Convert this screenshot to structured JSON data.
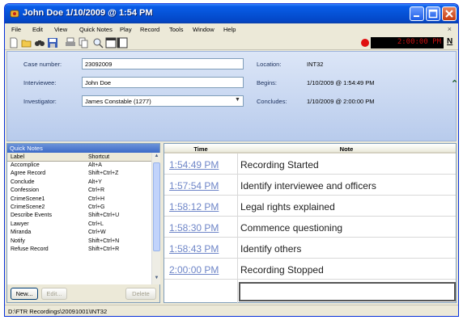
{
  "window": {
    "title": "John Doe 1/10/2009 @ 1:54 PM"
  },
  "menu": [
    "File",
    "Edit",
    "View",
    "Quick Notes",
    "Play",
    "Record",
    "Tools",
    "Window",
    "Help"
  ],
  "menu_close": "×",
  "toolbar": {
    "clock": "2:00:00 PM",
    "n_label": "N"
  },
  "info": {
    "case_number_label": "Case number:",
    "case_number": "23092009",
    "interviewee_label": "Interviewee:",
    "interviewee": "John Doe",
    "investigator_label": "Investigator:",
    "investigator": "James Constable (1277)",
    "location_label": "Location:",
    "location": "INT32",
    "begins_label": "Begins:",
    "begins": "1/10/2009 @ 1:54:49 PM",
    "concludes_label": "Concludes:",
    "concludes": "1/10/2009 @ 2:00:00 PM"
  },
  "quick_notes": {
    "title": "Quick Notes",
    "col_label": "Label",
    "col_shortcut": "Shortcut",
    "items": [
      {
        "label": "Accomplice",
        "shortcut": "Alt+A"
      },
      {
        "label": "Agree Record",
        "shortcut": "Shift+Ctrl+Z"
      },
      {
        "label": "Conclude",
        "shortcut": "Alt+Y"
      },
      {
        "label": "Confession",
        "shortcut": "Ctrl+R"
      },
      {
        "label": "CrimeScene1",
        "shortcut": "Ctrl+H"
      },
      {
        "label": "CrimeScene2",
        "shortcut": "Ctrl+G"
      },
      {
        "label": "Describe Events",
        "shortcut": "Shift+Ctrl+U"
      },
      {
        "label": "Lawyer",
        "shortcut": "Ctrl+L"
      },
      {
        "label": "Miranda",
        "shortcut": "Ctrl+W"
      },
      {
        "label": "Notify",
        "shortcut": "Shift+Ctrl+N"
      },
      {
        "label": "Refuse Record",
        "shortcut": "Shift+Ctrl+R"
      }
    ],
    "new_button": "New...",
    "edit_button": "Edit...",
    "delete_button": "Delete"
  },
  "notes": {
    "col_time": "Time",
    "col_note": "Note",
    "rows": [
      {
        "time": "1:54:49 PM",
        "note": "Recording Started"
      },
      {
        "time": "1:57:54 PM",
        "note": "Identify interviewee and officers"
      },
      {
        "time": "1:58:12 PM",
        "note": "Legal rights explained"
      },
      {
        "time": "1:58:30 PM",
        "note": "Commence questioning"
      },
      {
        "time": "1:58:43 PM",
        "note": "Identify others"
      },
      {
        "time": "2:00:00 PM",
        "note": "Recording Stopped"
      }
    ]
  },
  "status": {
    "path": "D:\\FTR Recordings\\20091001\\INT32"
  },
  "colors": {
    "titlebar": "#0552D6",
    "clock_text": "#C81010",
    "record_dot": "#E01010",
    "time_link": "#6F86C8"
  },
  "icons": [
    "app-icon",
    "new-icon",
    "open-icon",
    "find-icon",
    "save-icon",
    "print-icon",
    "copy-icon",
    "zoom-icon",
    "layout-icon",
    "record-icon",
    "collapse-icon"
  ]
}
